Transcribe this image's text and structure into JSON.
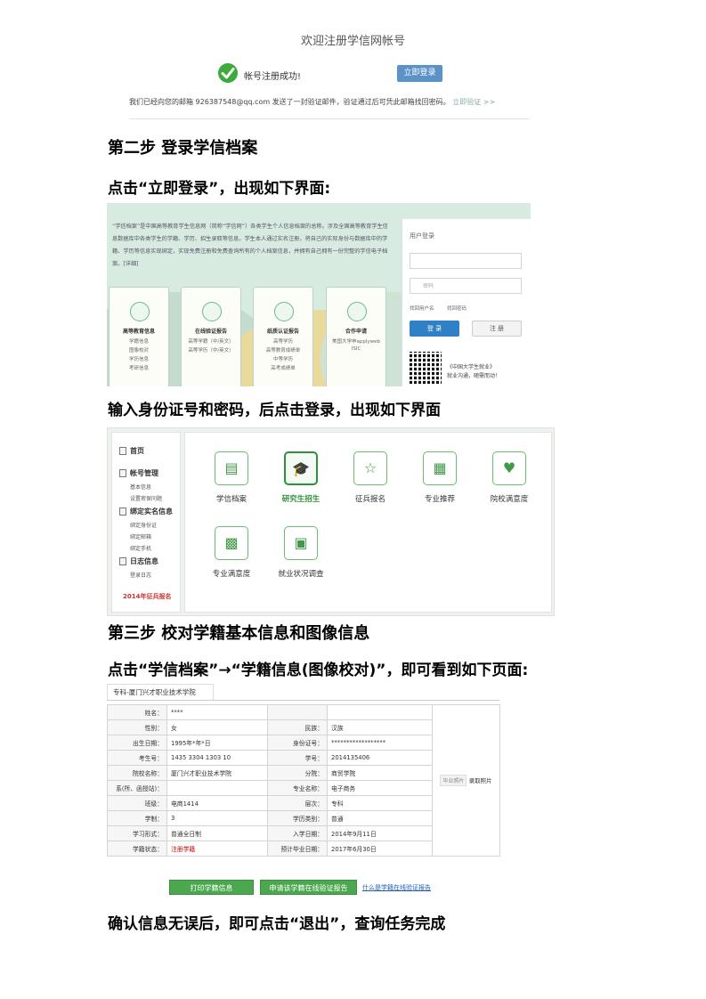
{
  "registration": {
    "title": "欢迎注册学信网帐号",
    "success_msg": "帐号注册成功!",
    "login_button": "立即登录",
    "note": "我们已经向您的邮箱 926387548@qq.com 发送了一封验证邮件，验证通过后可凭此邮箱找回密码。",
    "note_link": "立即验证 >>"
  },
  "step2": {
    "heading": "第二步 登录学信档案",
    "instruction": "点击“立即登录”，出现如下界面:"
  },
  "login_page": {
    "intro": "“学信档案”是中国高等教育学生信息网（简称“学信网”）各类学生个人信息档案的总称。涉及全国高等教育学生信息数据库中各类学生的学籍、学历、招生录取等信息。学生本人通过实名注册，将自己的实际身份与数据库中的学籍、学历等信息实现绑定，实现免费注册和免费查询所有的个人档案信息，并拥有自己拥有一份完整的学信电子档案。[详细]",
    "features": [
      {
        "title": "高等教育信息",
        "items": [
          "学籍信息",
          "图像校对",
          "学历信息",
          "考研信息"
        ]
      },
      {
        "title": "在线验证报告",
        "items": [
          "高等学籍（中/英文）",
          "高等学历（中/英文）"
        ]
      },
      {
        "title": "纸质认证报告",
        "items": [
          "高等学历",
          "高等教育成绩单",
          "中等学历",
          "高考成绩单"
        ]
      },
      {
        "title": "合作申请",
        "items": [
          "美国大学申applyweb",
          "ISIC"
        ]
      }
    ],
    "panel": {
      "title": "用户登录",
      "username_placeholder": "",
      "password_placeholder": "密码",
      "find_user": "找回用户名",
      "find_pwd": "找回密码",
      "login": "登 录",
      "register": "注 册",
      "qr_line1": "《中国大学生就业》",
      "qr_line2": "就业沟通，随需而动！"
    }
  },
  "step2b": {
    "instruction": "输入身份证号和密码，后点击登录，出现如下界面"
  },
  "dashboard": {
    "sidebar": [
      {
        "type": "head",
        "label": "首页"
      },
      {
        "type": "head",
        "label": "帐号管理"
      },
      {
        "type": "item",
        "label": "基本信息"
      },
      {
        "type": "item",
        "label": "设置密保问题"
      },
      {
        "type": "head",
        "label": "绑定实名信息"
      },
      {
        "type": "item",
        "label": "绑定身份证"
      },
      {
        "type": "item",
        "label": "绑定邮箱"
      },
      {
        "type": "item",
        "label": "绑定手机"
      },
      {
        "type": "head",
        "label": "日志信息"
      },
      {
        "type": "item",
        "label": "登录日志"
      },
      {
        "type": "red",
        "label": "2014年征兵报名"
      }
    ],
    "tiles": [
      {
        "label": "学信档案",
        "icon": "archive-icon",
        "glyph": "▤",
        "selected": false
      },
      {
        "label": "研究生招生",
        "icon": "graduation-cap-icon",
        "glyph": "🎓",
        "selected": true
      },
      {
        "label": "征兵报名",
        "icon": "star-icon",
        "glyph": "☆",
        "selected": false
      },
      {
        "label": "专业推荐",
        "icon": "thumbs-up-icon",
        "glyph": "▦",
        "selected": false
      },
      {
        "label": "院校满意度",
        "icon": "school-heart-icon",
        "glyph": "♥",
        "selected": false
      },
      {
        "label": "专业满意度",
        "icon": "grid-heart-icon",
        "glyph": "▩",
        "selected": false
      },
      {
        "label": "就业状况调查",
        "icon": "survey-icon",
        "glyph": "▣",
        "selected": false
      }
    ]
  },
  "step3": {
    "heading": "第三步  校对学籍基本信息和图像信息",
    "instruction": "点击“学信档案”→“学籍信息(图像校对)”，即可看到如下页面:"
  },
  "record": {
    "tab": "专科-厦门兴才职业技术学院",
    "rows": [
      {
        "k1": "姓名：",
        "v1": "****",
        "k2": "",
        "v2": ""
      },
      {
        "k1": "性别：",
        "v1": "女",
        "k2": "民族：",
        "v2": "汉族"
      },
      {
        "k1": "出生日期：",
        "v1": "1995年*年*日",
        "k2": "身份证号：",
        "v2": "******************"
      },
      {
        "k1": "考生号：",
        "v1": "1435 3304 1303 10",
        "k2": "学号：",
        "v2": "2014135406"
      },
      {
        "k1": "院校名称：",
        "v1": "厦门兴才职业技术学院",
        "k2": "分院：",
        "v2": "商贸学院"
      },
      {
        "k1": "系(所、函授站)：",
        "v1": "",
        "k2": "专业名称：",
        "v2": "电子商务"
      },
      {
        "k1": "班级：",
        "v1": "电商1414",
        "k2": "层次：",
        "v2": "专科"
      },
      {
        "k1": "学制：",
        "v1": "3",
        "k2": "学历类别：",
        "v2": "普通"
      },
      {
        "k1": "学习形式：",
        "v1": "普通全日制",
        "k2": "入学日期：",
        "v2": "2014年9月11日"
      },
      {
        "k1": "学籍状态：",
        "v1": "注册学籍",
        "k2": "预计毕业日期：",
        "v2": "2017年6月30日"
      }
    ],
    "photo_button": "毕业照片",
    "photo_label": "录取照片",
    "print_button": "打印学籍信息",
    "apply_button": "申请该学籍在线验证报告",
    "what_link": "什么是学籍在线验证报告"
  },
  "conclusion": "确认信息无误后，即可点击“退出”，查询任务完成",
  "colors": {
    "green": "#4ca84f",
    "blue": "#2f80c4",
    "red": "#c00"
  }
}
